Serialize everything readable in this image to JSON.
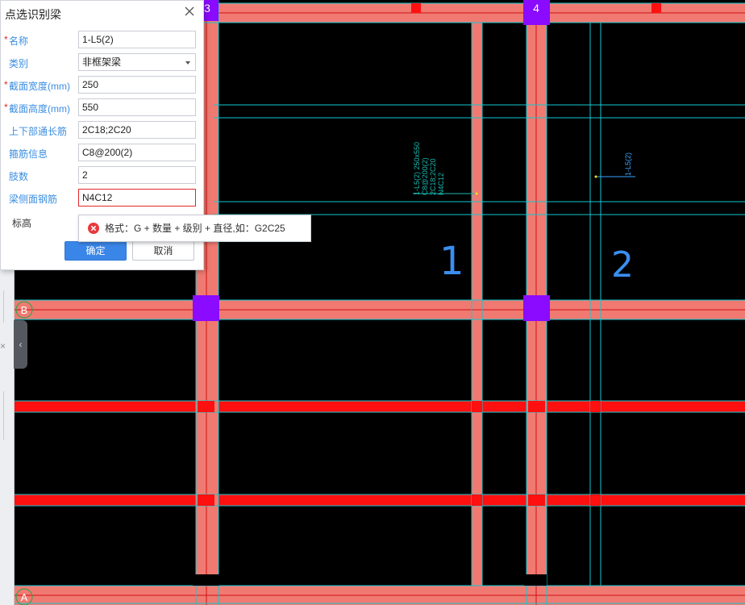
{
  "dialog": {
    "title": "点选识别梁",
    "fields": [
      {
        "label": "名称",
        "required": true,
        "value": "1-L5(2)"
      },
      {
        "label": "类别",
        "required": false,
        "value": "非框架梁",
        "type": "select"
      },
      {
        "label": "截面宽度(mm)",
        "required": true,
        "value": "250"
      },
      {
        "label": "截面高度(mm)",
        "required": true,
        "value": "550"
      },
      {
        "label": "上下部通长筋",
        "required": false,
        "value": "2C18;2C20"
      },
      {
        "label": "箍筋信息",
        "required": false,
        "value": "C8@200(2)"
      },
      {
        "label": "肢数",
        "required": false,
        "value": "2"
      },
      {
        "label": "梁侧面钢筋",
        "required": false,
        "value": "N4C12",
        "error": true
      }
    ],
    "elevation_label": "标高",
    "ok_label": "确定",
    "cancel_label": "取消"
  },
  "tooltip": {
    "text": "格式：G + 数量 + 级别 + 直径,如：G2C25"
  },
  "cad": {
    "axis_labels": {
      "top_left": "3",
      "top_right": "4",
      "left_b": "B",
      "left_a": "A"
    },
    "beam_annotation_lines": [
      "1-L5(2) 250x550",
      "C8@200(2)",
      "2C18;2C20",
      "N4C12"
    ],
    "beam_tag_right": "1-L5(2)",
    "handwritten_1": "1",
    "handwritten_2": "2",
    "colors": {
      "beam_fill": "#f07a72",
      "beam_red": "#ff1010",
      "column": "#8a0bff",
      "grid": "#10c8d0",
      "annotation": "#18b7b0"
    }
  }
}
